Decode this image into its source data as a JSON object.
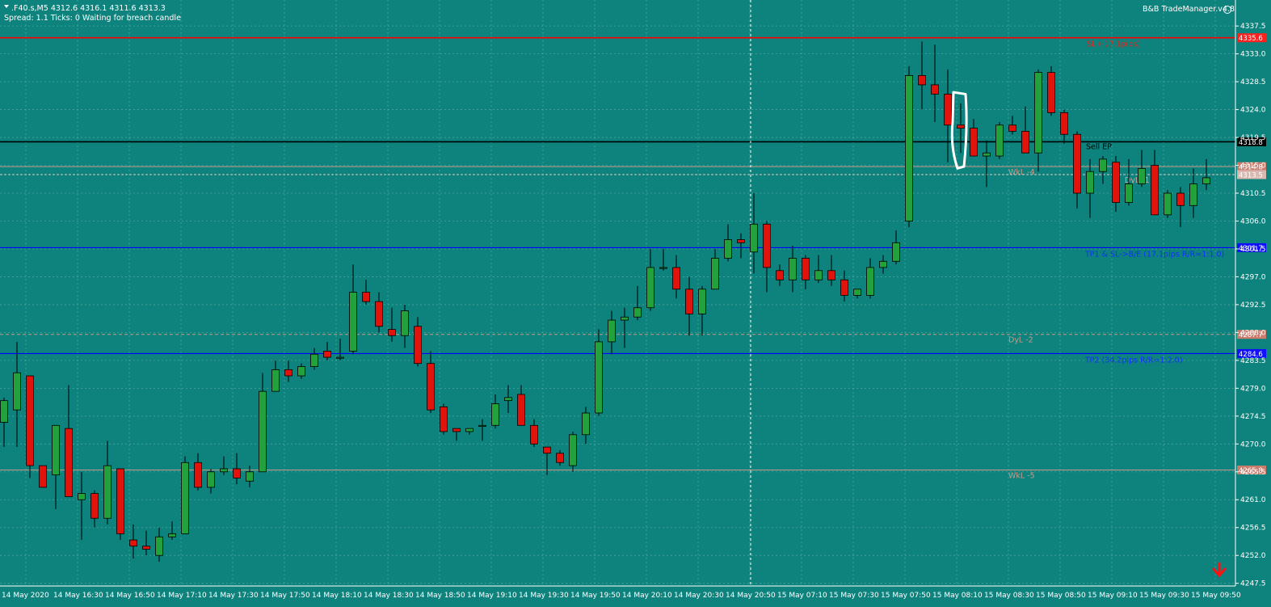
{
  "header": {
    "symbol_line": ".F40.s,M5  4312.6 4316.1 4311.6 4313.3",
    "status_line": "Spread: 1.1   Ticks: 0   Waiting for breach candle",
    "plugin": "B&B TradeManager.v4.8"
  },
  "colors": {
    "background": "#0e837d",
    "grid": "#7fbfb7",
    "bull": "#21a23a",
    "bear": "#e2120c",
    "wick": "#000000",
    "axis_text": "#ffffff",
    "sl_line": "#ff0000",
    "tp_line": "#0000ff",
    "level_line": "#c89a8a"
  },
  "price_axis": {
    "min": 4245.5,
    "max": 4340.0,
    "ticks": [
      "4337.5",
      "4333.0",
      "4328.5",
      "4324.0",
      "4319.5",
      "4315.0",
      "4310.5",
      "4306.0",
      "4301.5",
      "4297.0",
      "4292.5",
      "4288.0",
      "4283.5",
      "4279.0",
      "4274.5",
      "4270.0",
      "4265.5",
      "4261.0",
      "4256.5",
      "4252.0",
      "4247.5"
    ]
  },
  "time_axis": {
    "labels": [
      "14 May 2020",
      "14 May 16:30",
      "14 May 16:50",
      "14 May 17:10",
      "14 May 17:30",
      "14 May 17:50",
      "14 May 18:10",
      "14 May 18:30",
      "14 May 18:50",
      "14 May 19:10",
      "14 May 19:30",
      "14 May 19:50",
      "14 May 20:10",
      "14 May 20:30",
      "14 May 20:50",
      "15 May 07:10",
      "15 May 07:30",
      "15 May 07:50",
      "15 May 08:10",
      "15 May 08:30",
      "15 May 08:50",
      "15 May 09:10",
      "15 May 09:30",
      "15 May 09:50"
    ]
  },
  "levels": [
    {
      "price": 4335.6,
      "label": "SL (-17.1pips)",
      "style": "sl",
      "tag": "4335.6"
    },
    {
      "price": 4318.8,
      "label": "Sell EP",
      "style": "ep",
      "tag": "4318.8"
    },
    {
      "price": 4314.8,
      "label": "WkL -4",
      "style": "level",
      "tag": "4314.8"
    },
    {
      "price": 4313.5,
      "label": "DyL -1",
      "style": "level2",
      "tag": "4313.5"
    },
    {
      "price": 4301.7,
      "label": "TP1 & SL->B/E (17.1pips R/R=1:1.0)",
      "style": "tp",
      "tag": "4301.7"
    },
    {
      "price": 4287.7,
      "label": "DyL -2",
      "style": "level",
      "tag": "4287.7"
    },
    {
      "price": 4284.6,
      "label": "TP2 (34.2pips R/R=1:2.0)",
      "style": "tp",
      "tag": "4284.6"
    },
    {
      "price": 4265.8,
      "label": "WkL -5",
      "style": "level",
      "tag": "4265.8"
    }
  ],
  "chart_data": {
    "type": "candlestick",
    "timeframe": "M5",
    "candles": [
      {
        "o": 4273.5,
        "h": 4277.5,
        "l": 4269.5,
        "c": 4277.0
      },
      {
        "o": 4275.5,
        "h": 4286.5,
        "l": 4269.5,
        "c": 4281.5
      },
      {
        "o": 4281.0,
        "h": 4281.0,
        "l": 4264.5,
        "c": 4266.5
      },
      {
        "o": 4266.5,
        "h": 4266.5,
        "l": 4263.0,
        "c": 4263.0
      },
      {
        "o": 4265.0,
        "h": 4270.5,
        "l": 4259.5,
        "c": 4273.0
      },
      {
        "o": 4272.5,
        "h": 4279.5,
        "l": 4261.5,
        "c": 4261.5
      },
      {
        "o": 4261.0,
        "h": 4265.5,
        "l": 4254.5,
        "c": 4262.0
      },
      {
        "o": 4262.0,
        "h": 4262.5,
        "l": 4256.5,
        "c": 4258.0
      },
      {
        "o": 4258.0,
        "h": 4270.5,
        "l": 4257.0,
        "c": 4266.5
      },
      {
        "o": 4266.0,
        "h": 4266.0,
        "l": 4254.5,
        "c": 4255.5
      },
      {
        "o": 4254.5,
        "h": 4257.0,
        "l": 4251.5,
        "c": 4253.5
      },
      {
        "o": 4253.5,
        "h": 4256.0,
        "l": 4252.0,
        "c": 4253.0
      },
      {
        "o": 4252.0,
        "h": 4256.5,
        "l": 4251.0,
        "c": 4255.0
      },
      {
        "o": 4255.0,
        "h": 4257.5,
        "l": 4254.5,
        "c": 4255.5
      },
      {
        "o": 4255.5,
        "h": 4268.0,
        "l": 4255.5,
        "c": 4267.0
      },
      {
        "o": 4267.0,
        "h": 4268.5,
        "l": 4262.5,
        "c": 4263.0
      },
      {
        "o": 4263.0,
        "h": 4266.0,
        "l": 4262.0,
        "c": 4265.5
      },
      {
        "o": 4265.5,
        "h": 4268.0,
        "l": 4265.0,
        "c": 4266.0
      },
      {
        "o": 4266.0,
        "h": 4268.5,
        "l": 4263.5,
        "c": 4264.5
      },
      {
        "o": 4264.0,
        "h": 4266.5,
        "l": 4263.0,
        "c": 4265.5
      },
      {
        "o": 4265.5,
        "h": 4281.5,
        "l": 4265.5,
        "c": 4278.5
      },
      {
        "o": 4278.5,
        "h": 4283.5,
        "l": 4278.5,
        "c": 4282.0
      },
      {
        "o": 4282.0,
        "h": 4283.5,
        "l": 4280.0,
        "c": 4281.0
      },
      {
        "o": 4281.0,
        "h": 4283.0,
        "l": 4280.5,
        "c": 4282.5
      },
      {
        "o": 4282.5,
        "h": 4285.5,
        "l": 4282.0,
        "c": 4284.5
      },
      {
        "o": 4285.0,
        "h": 4286.5,
        "l": 4283.5,
        "c": 4284.0
      },
      {
        "o": 4284.0,
        "h": 4287.0,
        "l": 4283.5,
        "c": 4284.0
      },
      {
        "o": 4285.0,
        "h": 4299.0,
        "l": 4284.5,
        "c": 4294.5
      },
      {
        "o": 4294.5,
        "h": 4296.5,
        "l": 4292.5,
        "c": 4293.0
      },
      {
        "o": 4293.0,
        "h": 4294.5,
        "l": 4288.0,
        "c": 4289.0
      },
      {
        "o": 4288.5,
        "h": 4292.0,
        "l": 4286.5,
        "c": 4287.5
      },
      {
        "o": 4287.5,
        "h": 4292.5,
        "l": 4285.5,
        "c": 4291.5
      },
      {
        "o": 4289.0,
        "h": 4290.5,
        "l": 4282.5,
        "c": 4283.0
      },
      {
        "o": 4283.0,
        "h": 4285.0,
        "l": 4275.0,
        "c": 4275.5
      },
      {
        "o": 4276.0,
        "h": 4276.5,
        "l": 4271.5,
        "c": 4272.0
      },
      {
        "o": 4272.5,
        "h": 4272.5,
        "l": 4270.5,
        "c": 4272.0
      },
      {
        "o": 4272.0,
        "h": 4272.5,
        "l": 4271.5,
        "c": 4272.5
      },
      {
        "o": 4273.0,
        "h": 4274.0,
        "l": 4270.5,
        "c": 4273.0
      },
      {
        "o": 4273.0,
        "h": 4278.0,
        "l": 4272.5,
        "c": 4276.5
      },
      {
        "o": 4277.0,
        "h": 4279.5,
        "l": 4275.0,
        "c": 4277.5
      },
      {
        "o": 4278.0,
        "h": 4279.5,
        "l": 4273.0,
        "c": 4273.0
      },
      {
        "o": 4273.0,
        "h": 4274.0,
        "l": 4269.5,
        "c": 4270.0
      },
      {
        "o": 4269.5,
        "h": 4269.5,
        "l": 4265.0,
        "c": 4268.5
      },
      {
        "o": 4268.5,
        "h": 4269.0,
        "l": 4266.5,
        "c": 4267.0
      },
      {
        "o": 4266.5,
        "h": 4272.0,
        "l": 4265.5,
        "c": 4271.5
      },
      {
        "o": 4271.5,
        "h": 4276.0,
        "l": 4270.0,
        "c": 4275.0
      },
      {
        "o": 4275.0,
        "h": 4288.5,
        "l": 4274.5,
        "c": 4286.5
      },
      {
        "o": 4286.5,
        "h": 4291.5,
        "l": 4284.5,
        "c": 4290.0
      },
      {
        "o": 4290.0,
        "h": 4292.0,
        "l": 4285.5,
        "c": 4290.5
      },
      {
        "o": 4290.5,
        "h": 4295.5,
        "l": 4290.0,
        "c": 4292.0
      },
      {
        "o": 4292.0,
        "h": 4301.5,
        "l": 4291.5,
        "c": 4298.5
      },
      {
        "o": 4298.5,
        "h": 4301.5,
        "l": 4298.0,
        "c": 4298.5
      },
      {
        "o": 4298.5,
        "h": 4300.5,
        "l": 4293.5,
        "c": 4295.0
      },
      {
        "o": 4295.0,
        "h": 4297.0,
        "l": 4287.5,
        "c": 4291.0
      },
      {
        "o": 4291.0,
        "h": 4295.5,
        "l": 4287.5,
        "c": 4295.0
      },
      {
        "o": 4295.0,
        "h": 4301.5,
        "l": 4295.0,
        "c": 4300.0
      },
      {
        "o": 4300.0,
        "h": 4305.5,
        "l": 4299.5,
        "c": 4303.0
      },
      {
        "o": 4303.0,
        "h": 4304.0,
        "l": 4300.0,
        "c": 4302.5
      },
      {
        "o": 4301.0,
        "h": 4310.5,
        "l": 4297.5,
        "c": 4305.5
      },
      {
        "o": 4305.5,
        "h": 4306.0,
        "l": 4294.5,
        "c": 4298.5
      },
      {
        "o": 4298.0,
        "h": 4299.0,
        "l": 4295.5,
        "c": 4296.5
      },
      {
        "o": 4296.5,
        "h": 4302.0,
        "l": 4294.5,
        "c": 4300.0
      },
      {
        "o": 4300.0,
        "h": 4300.5,
        "l": 4295.0,
        "c": 4296.5
      },
      {
        "o": 4296.5,
        "h": 4300.5,
        "l": 4296.0,
        "c": 4298.0
      },
      {
        "o": 4298.0,
        "h": 4300.5,
        "l": 4295.5,
        "c": 4296.5
      },
      {
        "o": 4296.5,
        "h": 4298.0,
        "l": 4293.0,
        "c": 4294.0
      },
      {
        "o": 4294.0,
        "h": 4295.0,
        "l": 4293.5,
        "c": 4295.0
      },
      {
        "o": 4294.0,
        "h": 4300.0,
        "l": 4293.5,
        "c": 4298.5
      },
      {
        "o": 4298.5,
        "h": 4300.5,
        "l": 4297.5,
        "c": 4299.5
      },
      {
        "o": 4299.5,
        "h": 4304.5,
        "l": 4299.0,
        "c": 4302.5
      },
      {
        "o": 4306.0,
        "h": 4331.0,
        "l": 4305.0,
        "c": 4329.5
      },
      {
        "o": 4329.5,
        "h": 4335.0,
        "l": 4324.0,
        "c": 4328.0
      },
      {
        "o": 4328.0,
        "h": 4334.5,
        "l": 4322.0,
        "c": 4326.5
      },
      {
        "o": 4326.5,
        "h": 4330.5,
        "l": 4315.5,
        "c": 4321.5
      },
      {
        "o": 4321.5,
        "h": 4325.0,
        "l": 4317.0,
        "c": 4321.0
      },
      {
        "o": 4321.0,
        "h": 4322.5,
        "l": 4316.5,
        "c": 4316.5
      },
      {
        "o": 4316.5,
        "h": 4319.0,
        "l": 4311.5,
        "c": 4317.0
      },
      {
        "o": 4316.5,
        "h": 4322.0,
        "l": 4316.0,
        "c": 4321.5
      },
      {
        "o": 4321.5,
        "h": 4323.0,
        "l": 4320.0,
        "c": 4320.5
      },
      {
        "o": 4320.5,
        "h": 4324.5,
        "l": 4317.0,
        "c": 4317.0
      },
      {
        "o": 4317.0,
        "h": 4330.5,
        "l": 4314.0,
        "c": 4330.0
      },
      {
        "o": 4330.0,
        "h": 4331.0,
        "l": 4323.0,
        "c": 4323.5
      },
      {
        "o": 4323.5,
        "h": 4324.0,
        "l": 4318.5,
        "c": 4320.0
      },
      {
        "o": 4320.0,
        "h": 4320.5,
        "l": 4308.0,
        "c": 4310.5
      },
      {
        "o": 4310.5,
        "h": 4316.0,
        "l": 4306.5,
        "c": 4314.0
      },
      {
        "o": 4314.0,
        "h": 4316.5,
        "l": 4312.0,
        "c": 4316.0
      },
      {
        "o": 4315.5,
        "h": 4316.5,
        "l": 4307.5,
        "c": 4309.0
      },
      {
        "o": 4309.0,
        "h": 4316.0,
        "l": 4308.5,
        "c": 4312.0
      },
      {
        "o": 4312.0,
        "h": 4317.5,
        "l": 4311.5,
        "c": 4314.5
      },
      {
        "o": 4315.0,
        "h": 4317.5,
        "l": 4307.0,
        "c": 4307.0
      },
      {
        "o": 4307.0,
        "h": 4311.0,
        "l": 4306.5,
        "c": 4310.5
      },
      {
        "o": 4310.5,
        "h": 4311.5,
        "l": 4305.0,
        "c": 4308.5
      },
      {
        "o": 4308.5,
        "h": 4314.5,
        "l": 4306.5,
        "c": 4312.0
      },
      {
        "o": 4312.0,
        "h": 4316.0,
        "l": 4311.0,
        "c": 4313.0
      }
    ]
  },
  "annotation": {
    "type": "freehand-outline",
    "candle_index": 74
  },
  "alert_arrow": "red-down-arrow-icon"
}
